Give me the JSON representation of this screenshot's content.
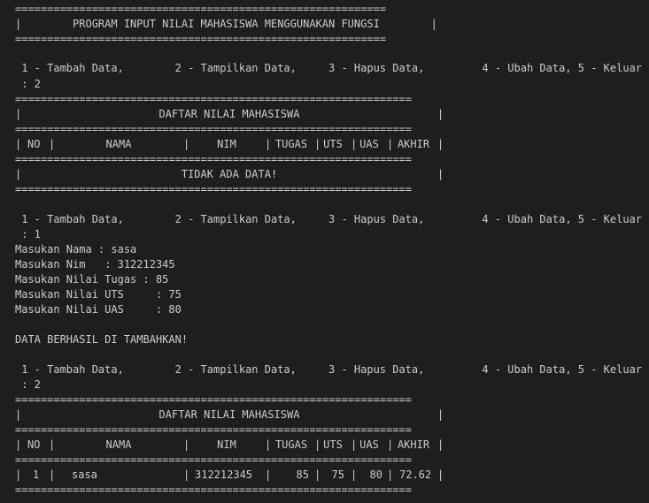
{
  "sep_short": "==========================================================",
  "sep_long": "==============================================================",
  "banner": "|        PROGRAM INPUT NILAI MAHASISWA MENGGUNAKAN FUNGSI        |",
  "menu": " 1 - Tambah Data,        2 - Tampilkan Data,     3 - Hapus Data,         4 - Ubah Data, 5 - Keluar",
  "choices": [
    " : 2",
    " : 1",
    " : 2"
  ],
  "table_title": "DAFTAR NILAI MAHASISWA",
  "columns": [
    "NO",
    "NAMA",
    "NIM",
    "TUGAS",
    "UTS",
    "UAS",
    "AKHIR"
  ],
  "empty_msg": "TIDAK ADA DATA!",
  "inputs": [
    "Masukan Nama : sasa",
    "Masukan Nim   : 312212345",
    "Masukan Nilai Tugas : 85",
    "Masukan Nilai UTS     : 75",
    "Masukan Nilai UAS     : 80"
  ],
  "success_msg": "DATA BERHASIL DI TAMBAHKAN!",
  "rows": [
    {
      "no": "1",
      "nama": "sasa",
      "nim": "312212345",
      "tugas": "85",
      "uts": "75",
      "uas": "80",
      "akhir": "72.62"
    }
  ]
}
